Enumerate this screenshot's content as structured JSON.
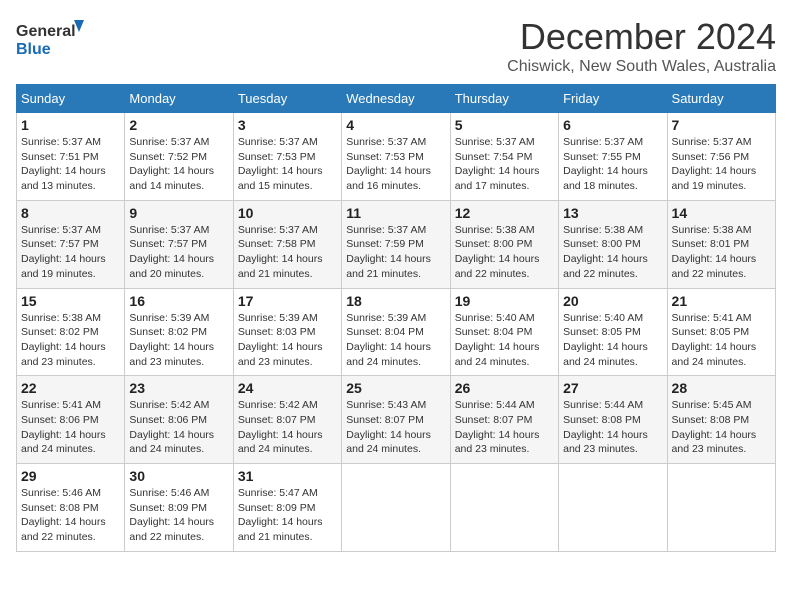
{
  "logo": {
    "line1": "General",
    "line2": "Blue"
  },
  "title": "December 2024",
  "location": "Chiswick, New South Wales, Australia",
  "weekdays": [
    "Sunday",
    "Monday",
    "Tuesday",
    "Wednesday",
    "Thursday",
    "Friday",
    "Saturday"
  ],
  "weeks": [
    [
      {
        "day": "1",
        "sunrise": "5:37 AM",
        "sunset": "7:51 PM",
        "daylight": "14 hours and 13 minutes."
      },
      {
        "day": "2",
        "sunrise": "5:37 AM",
        "sunset": "7:52 PM",
        "daylight": "14 hours and 14 minutes."
      },
      {
        "day": "3",
        "sunrise": "5:37 AM",
        "sunset": "7:53 PM",
        "daylight": "14 hours and 15 minutes."
      },
      {
        "day": "4",
        "sunrise": "5:37 AM",
        "sunset": "7:53 PM",
        "daylight": "14 hours and 16 minutes."
      },
      {
        "day": "5",
        "sunrise": "5:37 AM",
        "sunset": "7:54 PM",
        "daylight": "14 hours and 17 minutes."
      },
      {
        "day": "6",
        "sunrise": "5:37 AM",
        "sunset": "7:55 PM",
        "daylight": "14 hours and 18 minutes."
      },
      {
        "day": "7",
        "sunrise": "5:37 AM",
        "sunset": "7:56 PM",
        "daylight": "14 hours and 19 minutes."
      }
    ],
    [
      {
        "day": "8",
        "sunrise": "5:37 AM",
        "sunset": "7:57 PM",
        "daylight": "14 hours and 19 minutes."
      },
      {
        "day": "9",
        "sunrise": "5:37 AM",
        "sunset": "7:57 PM",
        "daylight": "14 hours and 20 minutes."
      },
      {
        "day": "10",
        "sunrise": "5:37 AM",
        "sunset": "7:58 PM",
        "daylight": "14 hours and 21 minutes."
      },
      {
        "day": "11",
        "sunrise": "5:37 AM",
        "sunset": "7:59 PM",
        "daylight": "14 hours and 21 minutes."
      },
      {
        "day": "12",
        "sunrise": "5:38 AM",
        "sunset": "8:00 PM",
        "daylight": "14 hours and 22 minutes."
      },
      {
        "day": "13",
        "sunrise": "5:38 AM",
        "sunset": "8:00 PM",
        "daylight": "14 hours and 22 minutes."
      },
      {
        "day": "14",
        "sunrise": "5:38 AM",
        "sunset": "8:01 PM",
        "daylight": "14 hours and 22 minutes."
      }
    ],
    [
      {
        "day": "15",
        "sunrise": "5:38 AM",
        "sunset": "8:02 PM",
        "daylight": "14 hours and 23 minutes."
      },
      {
        "day": "16",
        "sunrise": "5:39 AM",
        "sunset": "8:02 PM",
        "daylight": "14 hours and 23 minutes."
      },
      {
        "day": "17",
        "sunrise": "5:39 AM",
        "sunset": "8:03 PM",
        "daylight": "14 hours and 23 minutes."
      },
      {
        "day": "18",
        "sunrise": "5:39 AM",
        "sunset": "8:04 PM",
        "daylight": "14 hours and 24 minutes."
      },
      {
        "day": "19",
        "sunrise": "5:40 AM",
        "sunset": "8:04 PM",
        "daylight": "14 hours and 24 minutes."
      },
      {
        "day": "20",
        "sunrise": "5:40 AM",
        "sunset": "8:05 PM",
        "daylight": "14 hours and 24 minutes."
      },
      {
        "day": "21",
        "sunrise": "5:41 AM",
        "sunset": "8:05 PM",
        "daylight": "14 hours and 24 minutes."
      }
    ],
    [
      {
        "day": "22",
        "sunrise": "5:41 AM",
        "sunset": "8:06 PM",
        "daylight": "14 hours and 24 minutes."
      },
      {
        "day": "23",
        "sunrise": "5:42 AM",
        "sunset": "8:06 PM",
        "daylight": "14 hours and 24 minutes."
      },
      {
        "day": "24",
        "sunrise": "5:42 AM",
        "sunset": "8:07 PM",
        "daylight": "14 hours and 24 minutes."
      },
      {
        "day": "25",
        "sunrise": "5:43 AM",
        "sunset": "8:07 PM",
        "daylight": "14 hours and 24 minutes."
      },
      {
        "day": "26",
        "sunrise": "5:44 AM",
        "sunset": "8:07 PM",
        "daylight": "14 hours and 23 minutes."
      },
      {
        "day": "27",
        "sunrise": "5:44 AM",
        "sunset": "8:08 PM",
        "daylight": "14 hours and 23 minutes."
      },
      {
        "day": "28",
        "sunrise": "5:45 AM",
        "sunset": "8:08 PM",
        "daylight": "14 hours and 23 minutes."
      }
    ],
    [
      {
        "day": "29",
        "sunrise": "5:46 AM",
        "sunset": "8:08 PM",
        "daylight": "14 hours and 22 minutes."
      },
      {
        "day": "30",
        "sunrise": "5:46 AM",
        "sunset": "8:09 PM",
        "daylight": "14 hours and 22 minutes."
      },
      {
        "day": "31",
        "sunrise": "5:47 AM",
        "sunset": "8:09 PM",
        "daylight": "14 hours and 21 minutes."
      },
      null,
      null,
      null,
      null
    ]
  ],
  "labels": {
    "sunrise": "Sunrise:",
    "sunset": "Sunset:",
    "daylight": "Daylight:"
  }
}
